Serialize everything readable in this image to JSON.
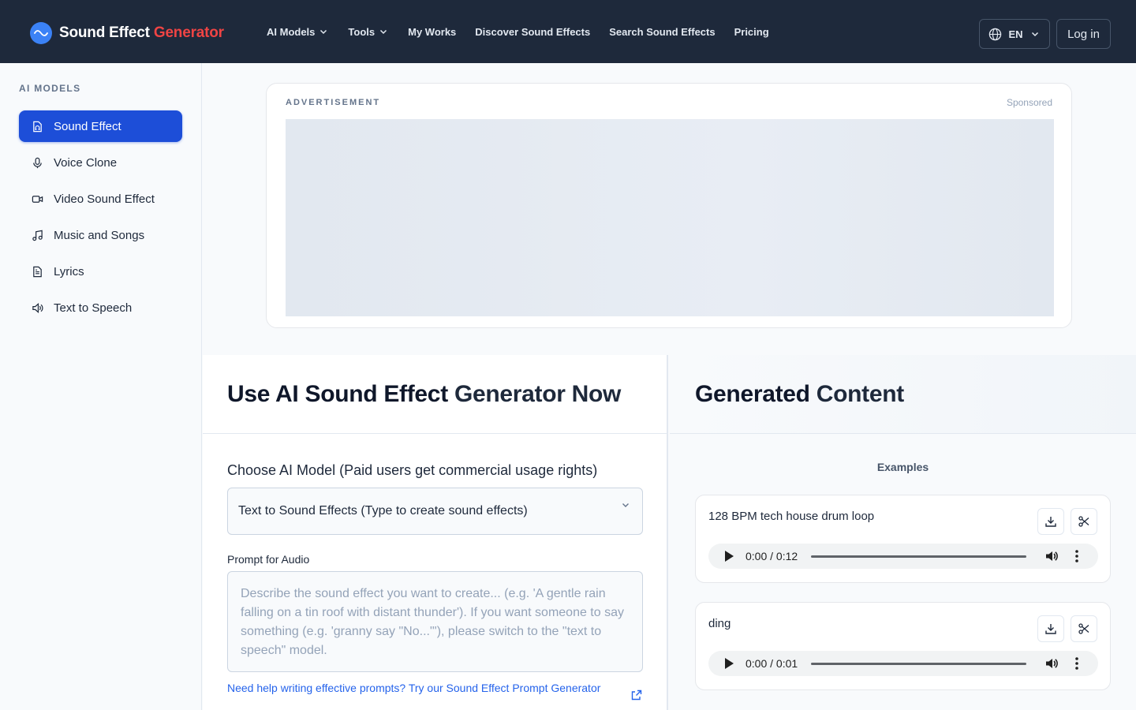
{
  "brand": {
    "name": "Sound Effect",
    "accent": "Generator"
  },
  "nav": {
    "items": [
      {
        "label": "AI Models",
        "dropdown": true
      },
      {
        "label": "Tools",
        "dropdown": true
      },
      {
        "label": "My Works",
        "dropdown": false
      },
      {
        "label": "Discover Sound Effects",
        "dropdown": false
      },
      {
        "label": "Search Sound Effects",
        "dropdown": false
      },
      {
        "label": "Pricing",
        "dropdown": false
      }
    ],
    "language": "EN",
    "login": "Log in"
  },
  "sidebar": {
    "heading": "AI MODELS",
    "items": [
      {
        "label": "Sound Effect",
        "icon": "headphones-file-icon",
        "active": true
      },
      {
        "label": "Voice Clone",
        "icon": "microphone-icon",
        "active": false
      },
      {
        "label": "Video Sound Effect",
        "icon": "video-camera-icon",
        "active": false
      },
      {
        "label": "Music and Songs",
        "icon": "music-note-icon",
        "active": false
      },
      {
        "label": "Lyrics",
        "icon": "document-icon",
        "active": false
      },
      {
        "label": "Text to Speech",
        "icon": "speaker-icon",
        "active": false
      }
    ]
  },
  "ad": {
    "label": "ADVERTISEMENT",
    "sponsored": "Sponsored"
  },
  "generator": {
    "title_main": "Use AI Sound Effect",
    "title_soft": "Generator Now",
    "model_label": "Choose AI Model (Paid users get commercial usage rights)",
    "model_value": "Text to Sound Effects (Type to create sound effects)",
    "prompt_label": "Prompt for Audio",
    "prompt_placeholder": "Describe the sound effect you want to create... (e.g. 'A gentle rain falling on a tin roof with distant thunder'). If you want someone to say something (e.g. 'granny say \"No...\"'), please switch to the \"text to speech\" model.",
    "help_link": "Need help writing effective prompts? Try our Sound Effect Prompt Generator"
  },
  "output": {
    "title_main": "Generated",
    "title_soft": "Content",
    "examples_heading": "Examples",
    "examples": [
      {
        "title": "128 BPM tech house drum loop",
        "time": "0:00 / 0:12"
      },
      {
        "title": "ding",
        "time": "0:00 / 0:01"
      }
    ]
  },
  "colors": {
    "nav_bg": "#1e293b",
    "accent_red": "#ef4444",
    "active_blue": "#1d4ed8",
    "link_blue": "#2563eb"
  }
}
